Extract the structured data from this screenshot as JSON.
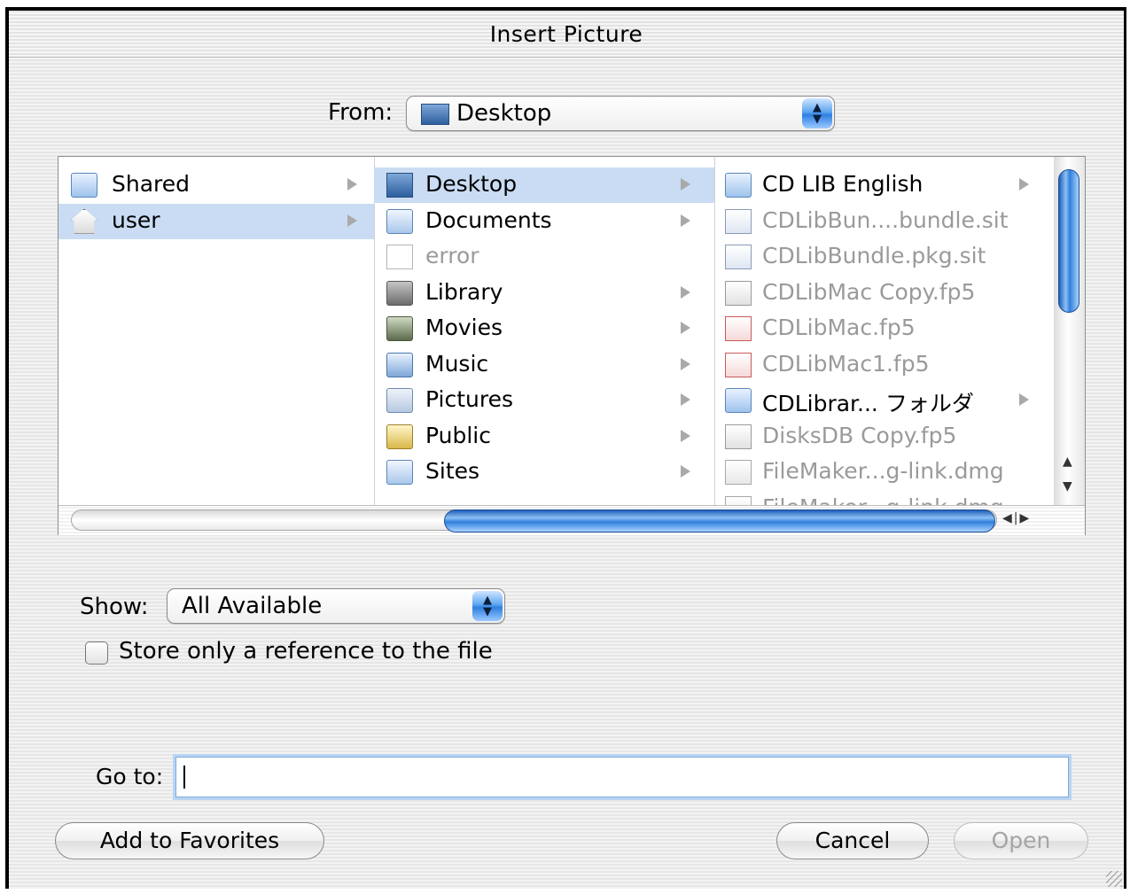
{
  "window": {
    "title": "Insert Picture"
  },
  "from": {
    "label": "From:",
    "value": "Desktop"
  },
  "browser": {
    "columns": [
      {
        "items": [
          {
            "name": "Shared",
            "icon": "folder-icon",
            "has_children": true,
            "selected": false,
            "dimmed": false
          },
          {
            "name": "user",
            "icon": "home-icon",
            "has_children": true,
            "selected": true,
            "dimmed": false
          }
        ]
      },
      {
        "items": [
          {
            "name": "Desktop",
            "icon": "desktop-folder-icon",
            "has_children": true,
            "selected": true,
            "dimmed": false
          },
          {
            "name": "Documents",
            "icon": "documents-folder-icon",
            "has_children": true,
            "selected": false,
            "dimmed": false
          },
          {
            "name": "error",
            "icon": "document-icon",
            "has_children": false,
            "selected": false,
            "dimmed": true
          },
          {
            "name": "Library",
            "icon": "library-folder-icon",
            "has_children": true,
            "selected": false,
            "dimmed": false
          },
          {
            "name": "Movies",
            "icon": "movies-folder-icon",
            "has_children": true,
            "selected": false,
            "dimmed": false
          },
          {
            "name": "Music",
            "icon": "music-folder-icon",
            "has_children": true,
            "selected": false,
            "dimmed": false
          },
          {
            "name": "Pictures",
            "icon": "pictures-folder-icon",
            "has_children": true,
            "selected": false,
            "dimmed": false
          },
          {
            "name": "Public",
            "icon": "public-folder-icon",
            "has_children": true,
            "selected": false,
            "dimmed": false
          },
          {
            "name": "Sites",
            "icon": "sites-folder-icon",
            "has_children": true,
            "selected": false,
            "dimmed": false
          }
        ]
      },
      {
        "items": [
          {
            "name": "CD LIB English",
            "icon": "folder-icon",
            "has_children": true,
            "selected": false,
            "dimmed": false
          },
          {
            "name": "CDLibBun....bundle.sit",
            "icon": "archive-icon",
            "has_children": false,
            "selected": false,
            "dimmed": true
          },
          {
            "name": "CDLibBundle.pkg.sit",
            "icon": "archive-icon",
            "has_children": false,
            "selected": false,
            "dimmed": true
          },
          {
            "name": "CDLibMac Copy.fp5",
            "icon": "filemaker-doc-icon",
            "has_children": false,
            "selected": false,
            "dimmed": true
          },
          {
            "name": "CDLibMac.fp5",
            "icon": "pdf-doc-icon",
            "has_children": false,
            "selected": false,
            "dimmed": true
          },
          {
            "name": "CDLibMac1.fp5",
            "icon": "pdf-doc-icon",
            "has_children": false,
            "selected": false,
            "dimmed": true
          },
          {
            "name": "CDLibrar... フォルダ",
            "icon": "folder-icon",
            "has_children": true,
            "selected": false,
            "dimmed": false
          },
          {
            "name": "DisksDB Copy.fp5",
            "icon": "filemaker-doc-icon",
            "has_children": false,
            "selected": false,
            "dimmed": true
          },
          {
            "name": "FileMaker...g-link.dmg",
            "icon": "disk-image-icon",
            "has_children": false,
            "selected": false,
            "dimmed": true
          },
          {
            "name": "FileMaker...g-link.dmg",
            "icon": "disk-image-icon",
            "has_children": false,
            "selected": false,
            "dimmed": true
          }
        ]
      }
    ]
  },
  "show": {
    "label": "Show:",
    "value": "All Available"
  },
  "reference_checkbox": {
    "label": "Store only a reference to the file",
    "checked": false
  },
  "goto": {
    "label": "Go to:",
    "value": ""
  },
  "buttons": {
    "add_favorites": "Add to Favorites",
    "cancel": "Cancel",
    "open": "Open"
  },
  "colors": {
    "selection": "#c9dcf3",
    "accent": "#2f80dd"
  }
}
